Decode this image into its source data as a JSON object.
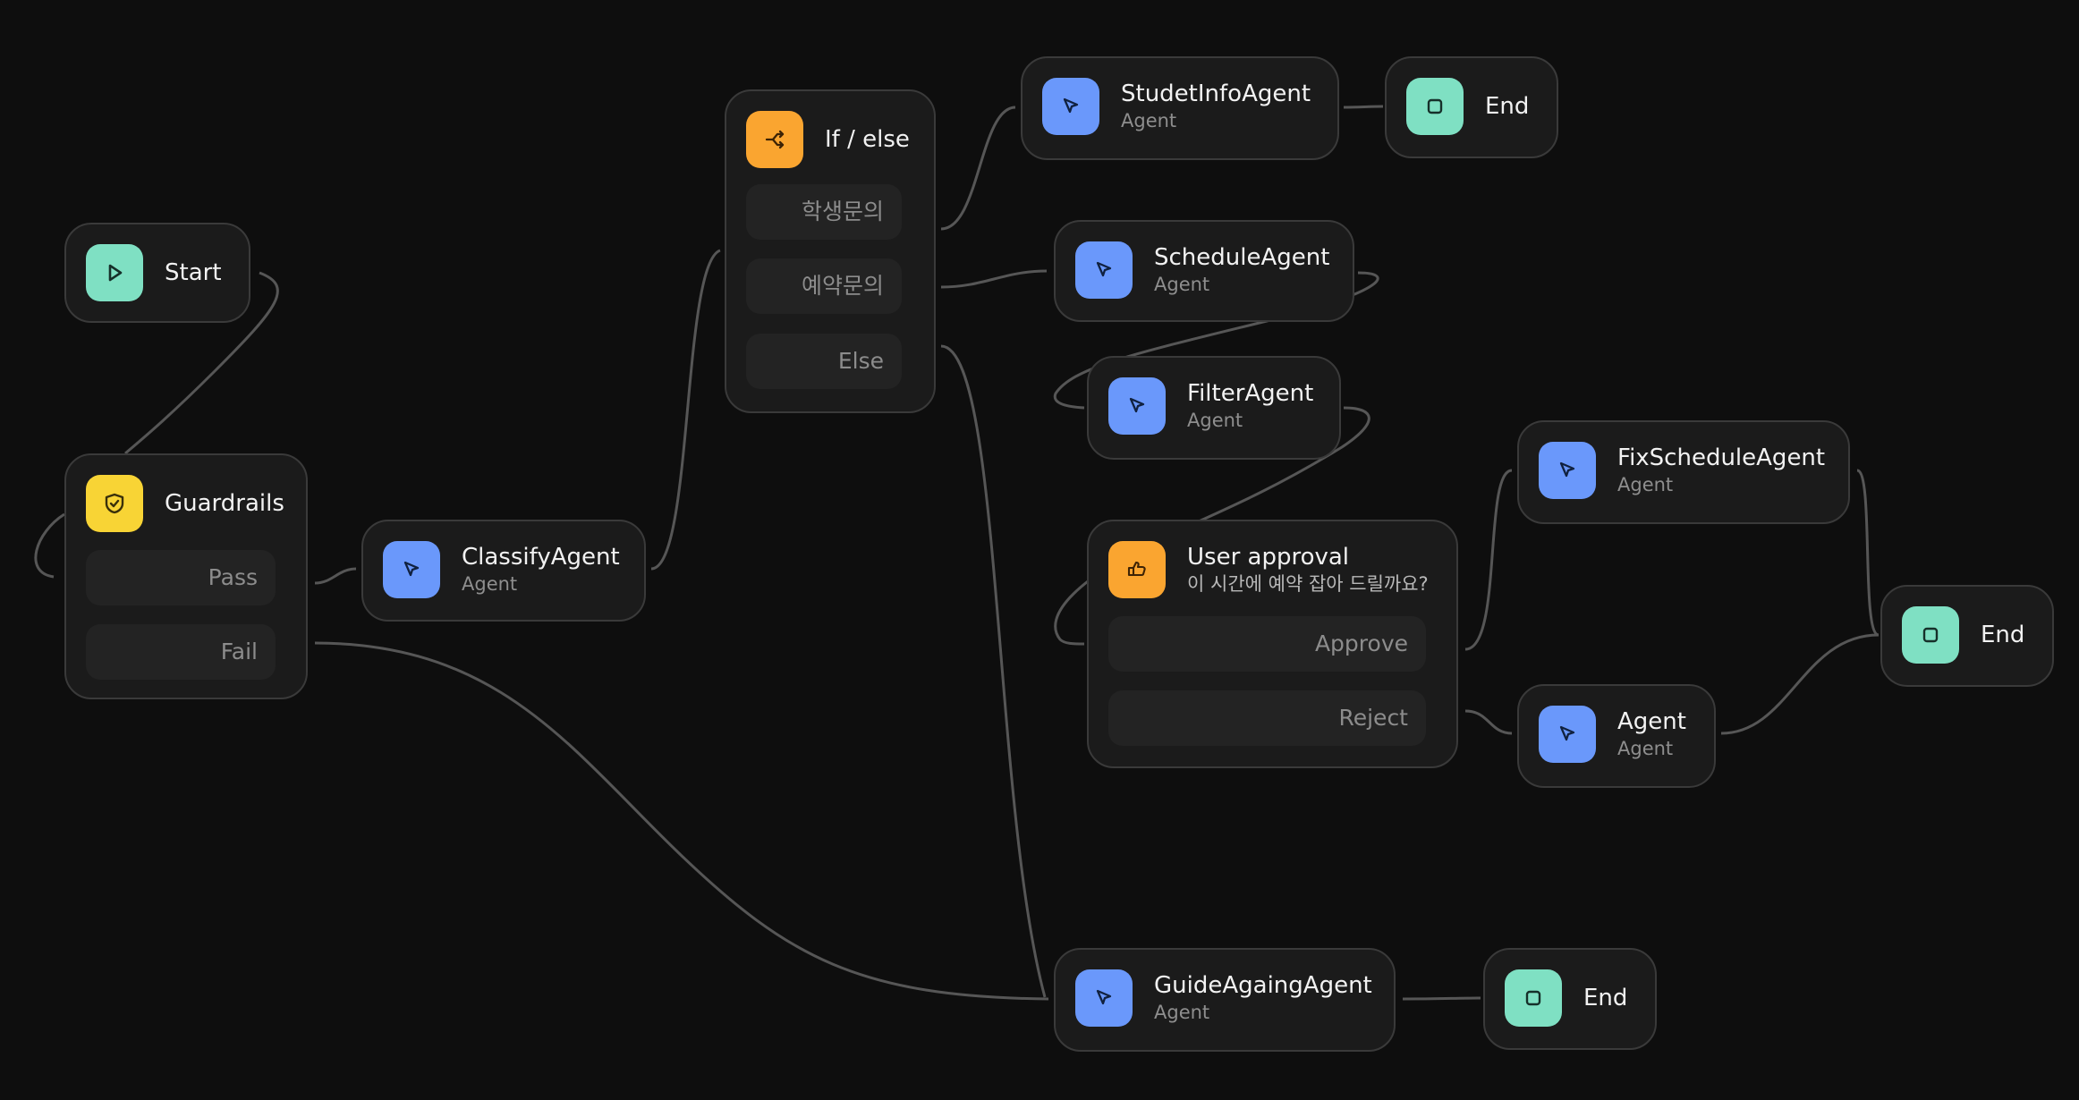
{
  "colors": {
    "background": "#0e0e0e",
    "node_bg": "#1b1b1b",
    "node_border": "#3a3a3a",
    "edge": "#565656",
    "agent_icon": "#6a98fb",
    "end_icon": "#7fe0c3",
    "guardrails_icon": "#f8d435",
    "decision_icon": "#faa530"
  },
  "nodes": {
    "start": {
      "title": "Start",
      "icon": "play-icon"
    },
    "guardrails": {
      "title": "Guardrails",
      "icon": "shield-check-icon",
      "branches": [
        "Pass",
        "Fail"
      ]
    },
    "classify": {
      "title": "ClassifyAgent",
      "subtitle": "Agent",
      "icon": "cursor-icon"
    },
    "ifelse": {
      "title": "If / else",
      "icon": "branch-icon",
      "branches": [
        "학생문의",
        "예약문의",
        "Else"
      ]
    },
    "studentinfo": {
      "title": "StudetInfoAgent",
      "subtitle": "Agent",
      "icon": "cursor-icon"
    },
    "end1": {
      "title": "End",
      "icon": "stop-icon"
    },
    "schedule": {
      "title": "ScheduleAgent",
      "subtitle": "Agent",
      "icon": "cursor-icon"
    },
    "filter": {
      "title": "FilterAgent",
      "subtitle": "Agent",
      "icon": "cursor-icon"
    },
    "approval": {
      "title": "User approval",
      "subtitle": "이 시간에 예약 잡아 드릴까요?",
      "icon": "thumbs-icon",
      "branches": [
        "Approve",
        "Reject"
      ]
    },
    "fixschedule": {
      "title": "FixScheduleAgent",
      "subtitle": "Agent",
      "icon": "cursor-icon"
    },
    "agent": {
      "title": "Agent",
      "subtitle": "Agent",
      "icon": "cursor-icon"
    },
    "end2": {
      "title": "End",
      "icon": "stop-icon"
    },
    "guideagain": {
      "title": "GuideAgaingAgent",
      "subtitle": "Agent",
      "icon": "cursor-icon"
    },
    "end3": {
      "title": "End",
      "icon": "stop-icon"
    }
  }
}
